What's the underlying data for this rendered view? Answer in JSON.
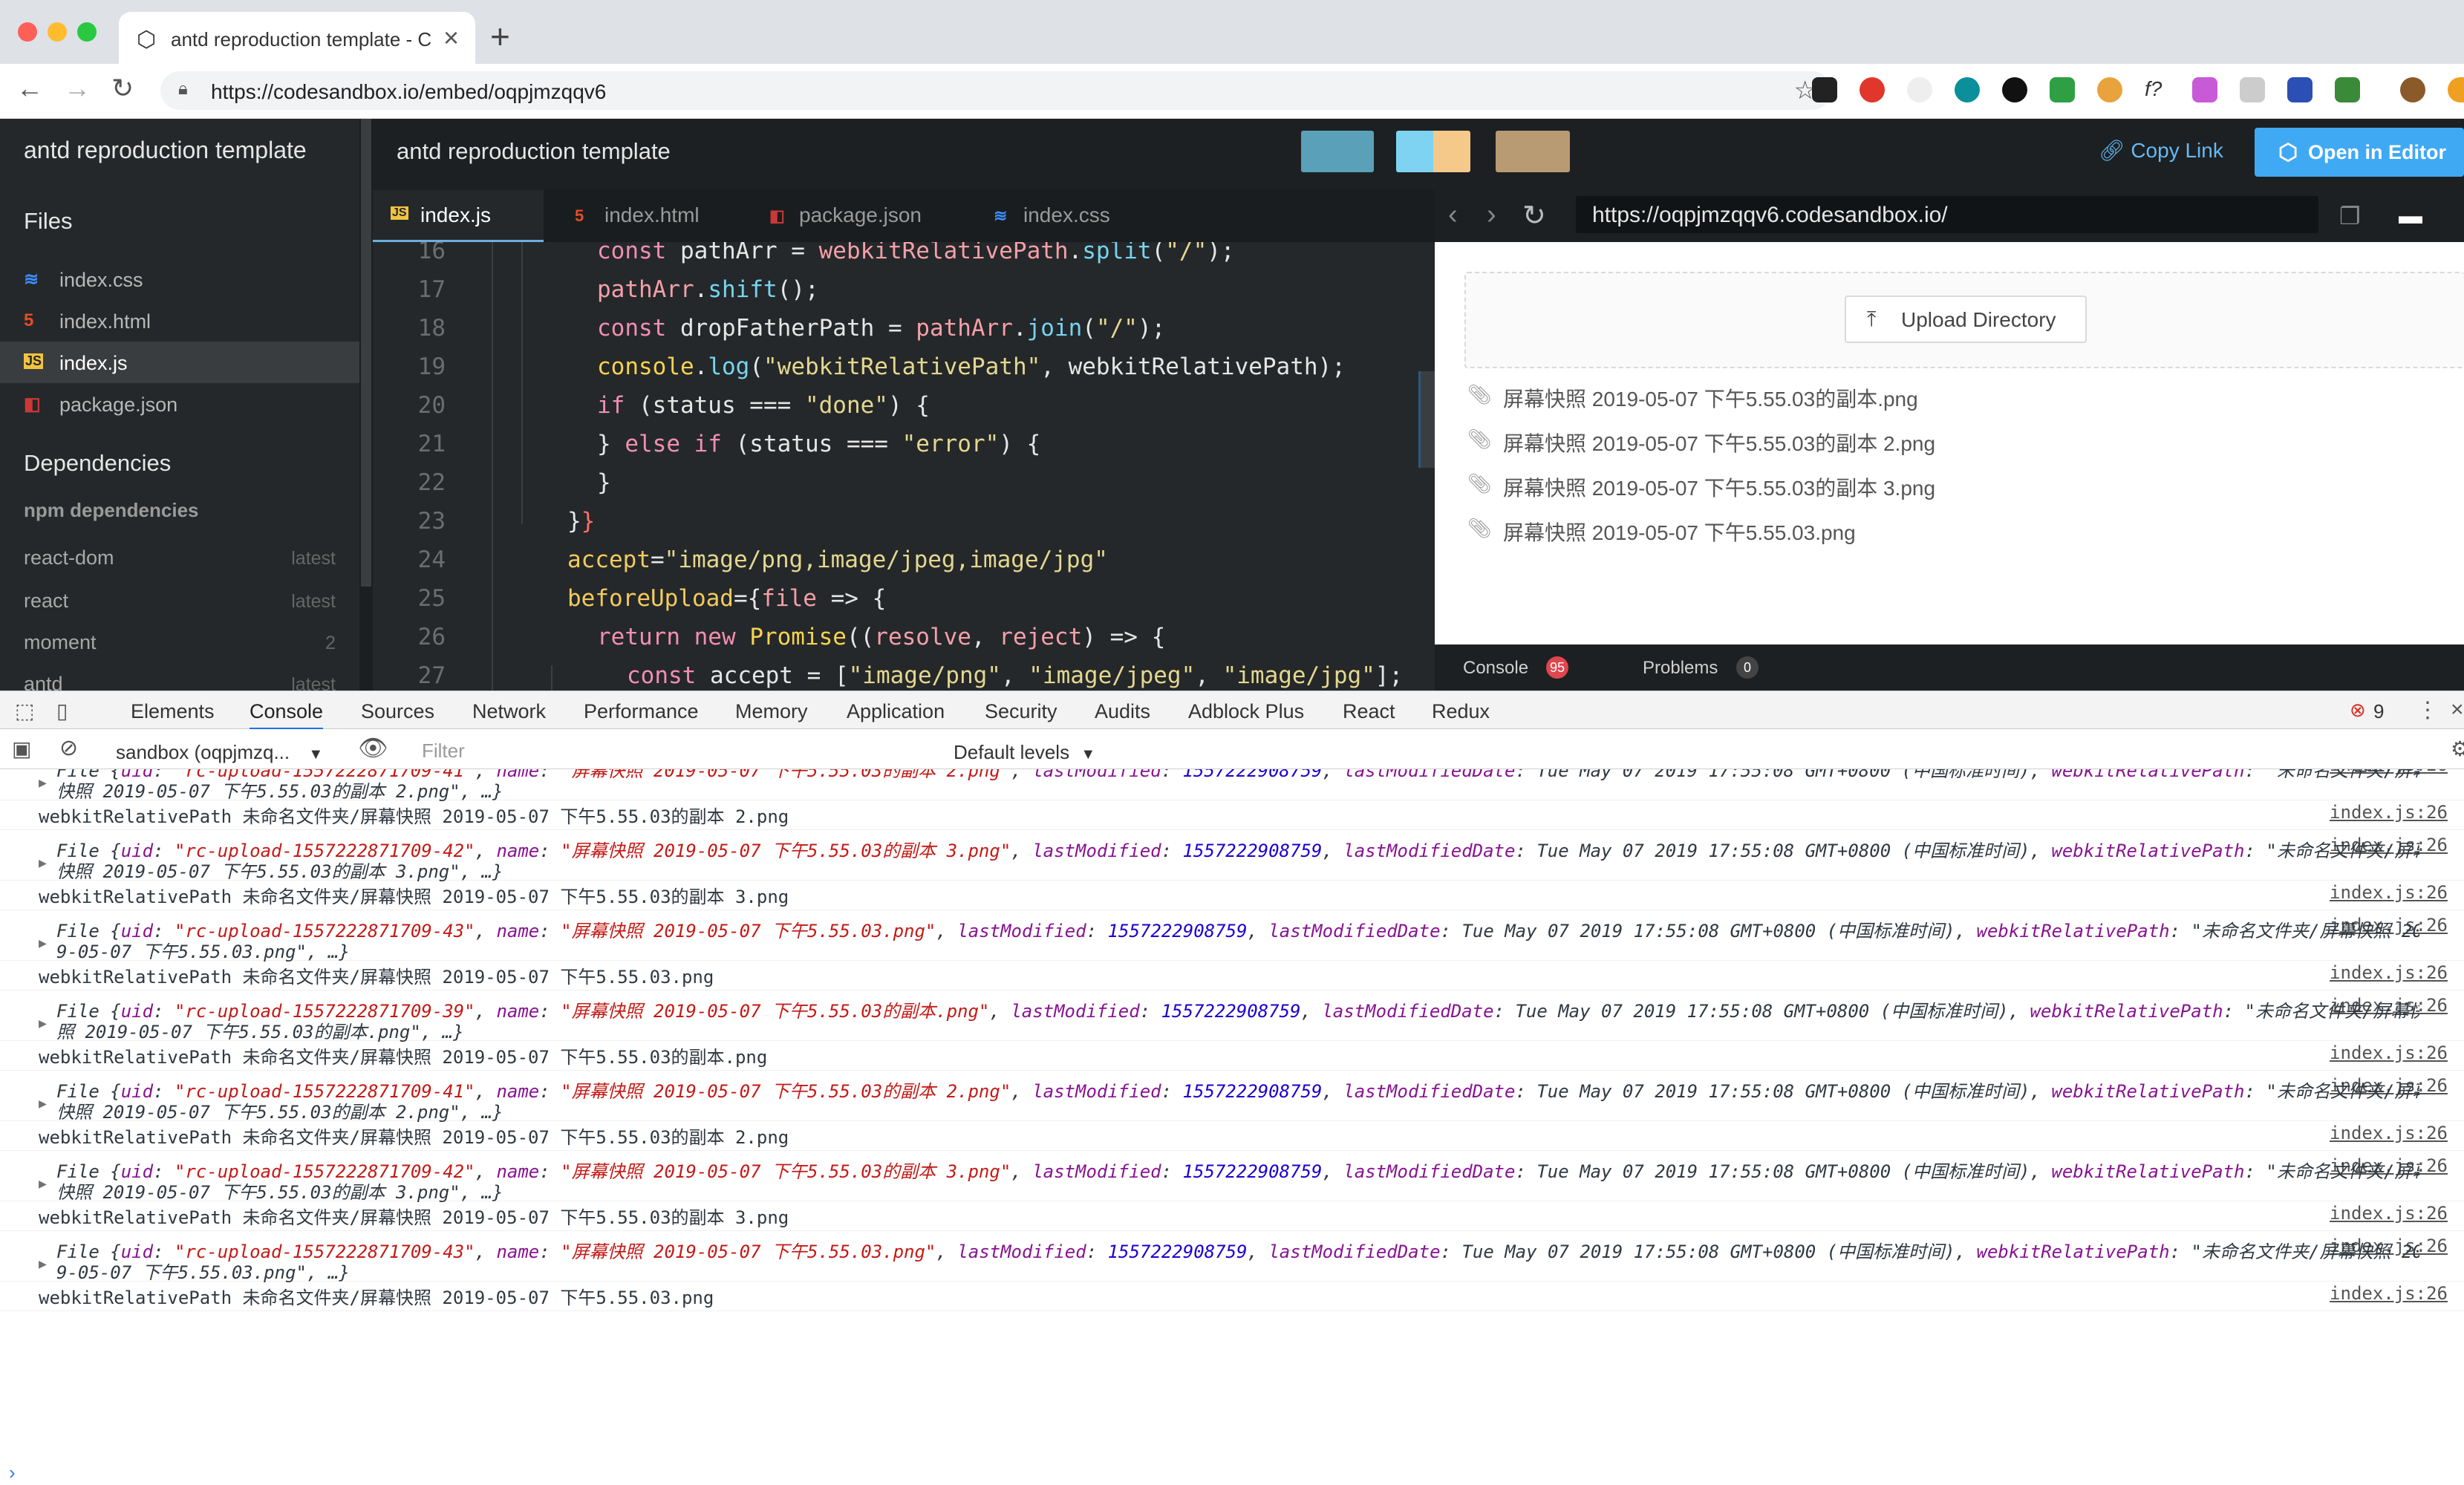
{
  "browser": {
    "tab_title": "antd reproduction template - C",
    "url": "https://codesandbox.io/embed/oqpjmzqqv6"
  },
  "sandbox": {
    "brand": "antd reproduction template",
    "header_title": "antd reproduction template",
    "copy_link": "Copy Link",
    "open_in_editor": "Open in Editor",
    "swatch_colors": [
      "#5aa0b8",
      "#7fd3f2",
      "#f4c98a",
      "#b89a73"
    ],
    "sidebar": {
      "files_heading": "Files",
      "files": [
        {
          "name": "index.css",
          "icon": "css-file-icon"
        },
        {
          "name": "index.html",
          "icon": "html-file-icon"
        },
        {
          "name": "index.js",
          "icon": "js-file-icon",
          "active": true
        },
        {
          "name": "package.json",
          "icon": "npm-file-icon"
        }
      ],
      "deps_heading": "Dependencies",
      "npm_heading": "npm dependencies",
      "deps": [
        {
          "name": "react-dom",
          "version": "latest"
        },
        {
          "name": "react",
          "version": "latest"
        },
        {
          "name": "moment",
          "version": "2"
        },
        {
          "name": "antd",
          "version": "latest"
        }
      ]
    },
    "editor_tabs": [
      "index.js",
      "index.html",
      "package.json",
      "index.css"
    ],
    "code_lines": [
      {
        "n": "16",
        "text": "const pathArr = webkitRelativePath.split(\"/\");"
      },
      {
        "n": "17",
        "text": "pathArr.shift();"
      },
      {
        "n": "18",
        "text": "const dropFatherPath = pathArr.join(\"/\");"
      },
      {
        "n": "19",
        "text": "console.log(\"webkitRelativePath\", webkitRelativePath);"
      },
      {
        "n": "20",
        "text": "if (status === \"done\") {"
      },
      {
        "n": "21",
        "text": "} else if (status === \"error\") {"
      },
      {
        "n": "22",
        "text": "}"
      },
      {
        "n": "23",
        "text": "}}"
      },
      {
        "n": "24",
        "text": "accept=\"image/png,image/jpeg,image/jpg\""
      },
      {
        "n": "25",
        "text": "beforeUpload={file => {"
      },
      {
        "n": "26",
        "text": "return new Promise((resolve, reject) => {"
      },
      {
        "n": "27",
        "text": "const accept = [\"image/png\", \"image/jpeg\", \"image/jpg\"];"
      }
    ],
    "preview_url": "https://oqpjmzqqv6.codesandbox.io/",
    "upload_button": "Upload Directory",
    "uploads": [
      "屏幕快照 2019-05-07 下午5.55.03的副本.png",
      "屏幕快照 2019-05-07 下午5.55.03的副本 2.png",
      "屏幕快照 2019-05-07 下午5.55.03的副本 3.png",
      "屏幕快照 2019-05-07 下午5.55.03.png"
    ],
    "console_tab": "Console",
    "console_count": "95",
    "problems_tab": "Problems",
    "problems_count": "0"
  },
  "devtools": {
    "tabs": [
      "Elements",
      "Console",
      "Sources",
      "Network",
      "Performance",
      "Memory",
      "Application",
      "Security",
      "Audits",
      "Adblock Plus",
      "React",
      "Redux"
    ],
    "active_tab": "Console",
    "error_count": "9",
    "context": "sandbox (oqpjmzq...",
    "filter_placeholder": "Filter",
    "levels": "Default levels",
    "source": "index.js:26",
    "messages": [
      {
        "type": "file",
        "line1": "File {uid: \"rc-upload-1557222871709-41\", name: \"屏幕快照 2019-05-07 下午5.55.03的副本 2.png\", lastModified: 1557222908759, lastModifiedDate: Tue May 07 2019 17:55:08 GMT+0800 (中国标准时间), webkitRelativePath: \"未命名文件夹/屏幕",
        "line2": "快照 2019-05-07 下午5.55.03的副本 2.png\", …}"
      },
      {
        "type": "log",
        "text": "webkitRelativePath 未命名文件夹/屏幕快照 2019-05-07 下午5.55.03的副本 2.png"
      },
      {
        "type": "file",
        "line1": "File {uid: \"rc-upload-1557222871709-42\", name: \"屏幕快照 2019-05-07 下午5.55.03的副本 3.png\", lastModified: 1557222908759, lastModifiedDate: Tue May 07 2019 17:55:08 GMT+0800 (中国标准时间), webkitRelativePath: \"未命名文件夹/屏幕",
        "line2": "快照 2019-05-07 下午5.55.03的副本 3.png\", …}"
      },
      {
        "type": "log",
        "text": "webkitRelativePath 未命名文件夹/屏幕快照 2019-05-07 下午5.55.03的副本 3.png"
      },
      {
        "type": "file",
        "line1": "File {uid: \"rc-upload-1557222871709-43\", name: \"屏幕快照 2019-05-07 下午5.55.03.png\", lastModified: 1557222908759, lastModifiedDate: Tue May 07 2019 17:55:08 GMT+0800 (中国标准时间), webkitRelativePath: \"未命名文件夹/屏幕快照 201",
        "line2": "9-05-07 下午5.55.03.png\", …}"
      },
      {
        "type": "log",
        "text": "webkitRelativePath 未命名文件夹/屏幕快照 2019-05-07 下午5.55.03.png"
      },
      {
        "type": "file",
        "line1": "File {uid: \"rc-upload-1557222871709-39\", name: \"屏幕快照 2019-05-07 下午5.55.03的副本.png\", lastModified: 1557222908759, lastModifiedDate: Tue May 07 2019 17:55:08 GMT+0800 (中国标准时间), webkitRelativePath: \"未命名文件夹/屏幕快",
        "line2": "照 2019-05-07 下午5.55.03的副本.png\", …}"
      },
      {
        "type": "log",
        "text": "webkitRelativePath 未命名文件夹/屏幕快照 2019-05-07 下午5.55.03的副本.png"
      },
      {
        "type": "file",
        "line1": "File {uid: \"rc-upload-1557222871709-41\", name: \"屏幕快照 2019-05-07 下午5.55.03的副本 2.png\", lastModified: 1557222908759, lastModifiedDate: Tue May 07 2019 17:55:08 GMT+0800 (中国标准时间), webkitRelativePath: \"未命名文件夹/屏幕",
        "line2": "快照 2019-05-07 下午5.55.03的副本 2.png\", …}"
      },
      {
        "type": "log",
        "text": "webkitRelativePath 未命名文件夹/屏幕快照 2019-05-07 下午5.55.03的副本 2.png"
      },
      {
        "type": "file",
        "line1": "File {uid: \"rc-upload-1557222871709-42\", name: \"屏幕快照 2019-05-07 下午5.55.03的副本 3.png\", lastModified: 1557222908759, lastModifiedDate: Tue May 07 2019 17:55:08 GMT+0800 (中国标准时间), webkitRelativePath: \"未命名文件夹/屏幕",
        "line2": "快照 2019-05-07 下午5.55.03的副本 3.png\", …}"
      },
      {
        "type": "log",
        "text": "webkitRelativePath 未命名文件夹/屏幕快照 2019-05-07 下午5.55.03的副本 3.png"
      },
      {
        "type": "file",
        "line1": "File {uid: \"rc-upload-1557222871709-43\", name: \"屏幕快照 2019-05-07 下午5.55.03.png\", lastModified: 1557222908759, lastModifiedDate: Tue May 07 2019 17:55:08 GMT+0800 (中国标准时间), webkitRelativePath: \"未命名文件夹/屏幕快照 201",
        "line2": "9-05-07 下午5.55.03.png\", …}"
      },
      {
        "type": "log",
        "text": "webkitRelativePath 未命名文件夹/屏幕快照 2019-05-07 下午5.55.03.png"
      }
    ]
  }
}
